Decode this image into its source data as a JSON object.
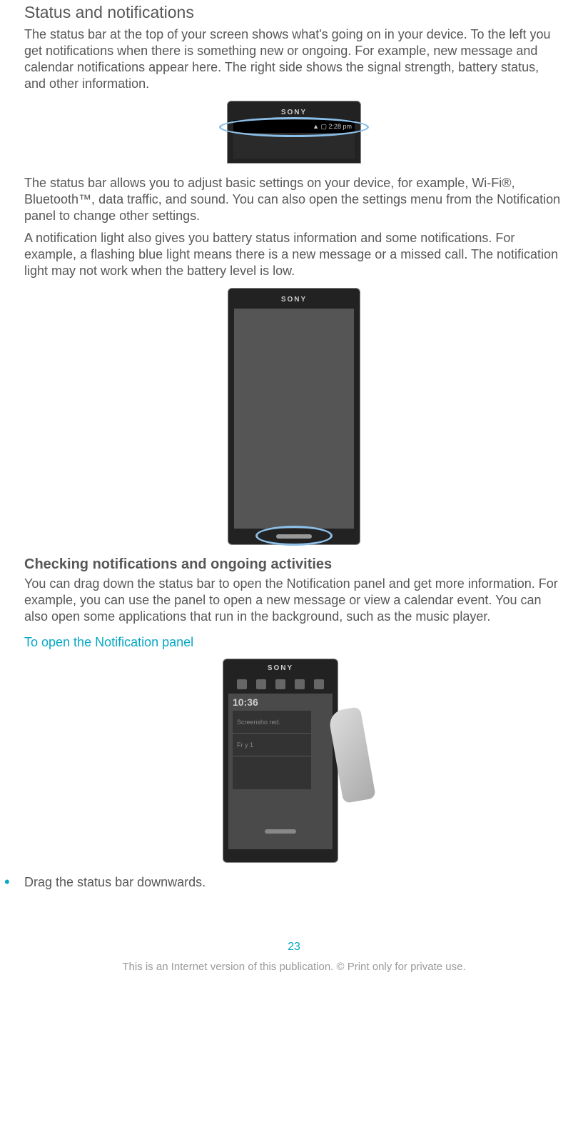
{
  "heading": "Status and notifications",
  "para1": "The status bar at the top of your screen shows what's going on in your device. To the left you get notifications when there is something new or ongoing. For example, new message and calendar notifications appear here. The right side shows the signal strength, battery status, and other information.",
  "fig1": {
    "brand": "SONY",
    "statusbar_text": "▲ ▢ 2:28 pm"
  },
  "para2": "The status bar allows you to adjust basic settings on your device, for example, Wi-Fi®, Bluetooth™, data traffic, and sound. You can also open the settings menu from the Notification panel to change other settings.",
  "para3": "A notification light also gives you battery status information and some notifications. For example, a flashing blue light means there is a new message or a missed call. The notification light may not work when the battery level is low.",
  "fig2": {
    "brand": "SONY"
  },
  "subheading": "Checking notifications and ongoing activities",
  "para4": "You can drag down the status bar to open the Notification panel and get more information. For example, you can use the panel to open a new message or view a calendar event. You can also open some applications that run in the background, such as the music player.",
  "task": "To open the Notification panel",
  "fig3": {
    "brand": "SONY",
    "time": "10:36",
    "rows": [
      "Screensho   red.",
      "Fr    y 1"
    ]
  },
  "bullet": "Drag the status bar downwards.",
  "page_number": "23",
  "footer": "This is an Internet version of this publication. © Print only for private use."
}
